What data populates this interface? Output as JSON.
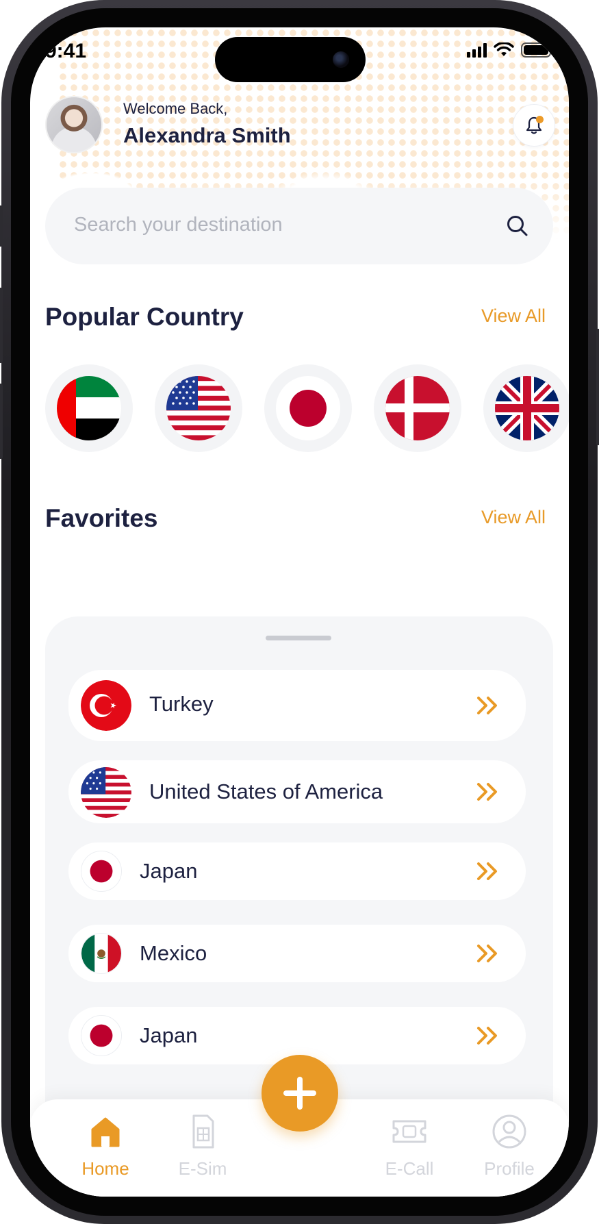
{
  "status_bar": {
    "time": "9:41"
  },
  "header": {
    "welcome": "Welcome Back,",
    "user_name": "Alexandra Smith"
  },
  "search": {
    "placeholder": "Search your destination"
  },
  "popular": {
    "title": "Popular Country",
    "view_all": "View All",
    "flags": [
      "uae-flag-icon",
      "usa-flag-icon",
      "japan-flag-icon",
      "denmark-flag-icon",
      "uk-flag-icon"
    ]
  },
  "favorites": {
    "title": "Favorites",
    "view_all": "View All",
    "items": [
      {
        "label": "Turkey",
        "icon": "turkey-flag-icon"
      },
      {
        "label": "United States of America",
        "icon": "usa-flag-icon"
      },
      {
        "label": "Japan",
        "icon": "japan-flag-icon"
      },
      {
        "label": "Mexico",
        "icon": "mexico-flag-icon"
      },
      {
        "label": "Japan",
        "icon": "japan-flag-icon"
      }
    ]
  },
  "tabbar": {
    "items": [
      {
        "label": "Home",
        "icon": "home-icon",
        "active": true
      },
      {
        "label": "E-Sim",
        "icon": "sim-card-icon",
        "active": false
      },
      {
        "label": "E-Call",
        "icon": "ticket-icon",
        "active": false
      },
      {
        "label": "Profile",
        "icon": "profile-icon",
        "active": false
      }
    ],
    "fab_icon": "plus-icon"
  },
  "colors": {
    "accent": "#E99A26",
    "text_primary": "#1D2140",
    "placeholder": "#B1B4BD",
    "panel_bg": "#F5F6F8",
    "inactive_tab": "#D3D5DB"
  }
}
